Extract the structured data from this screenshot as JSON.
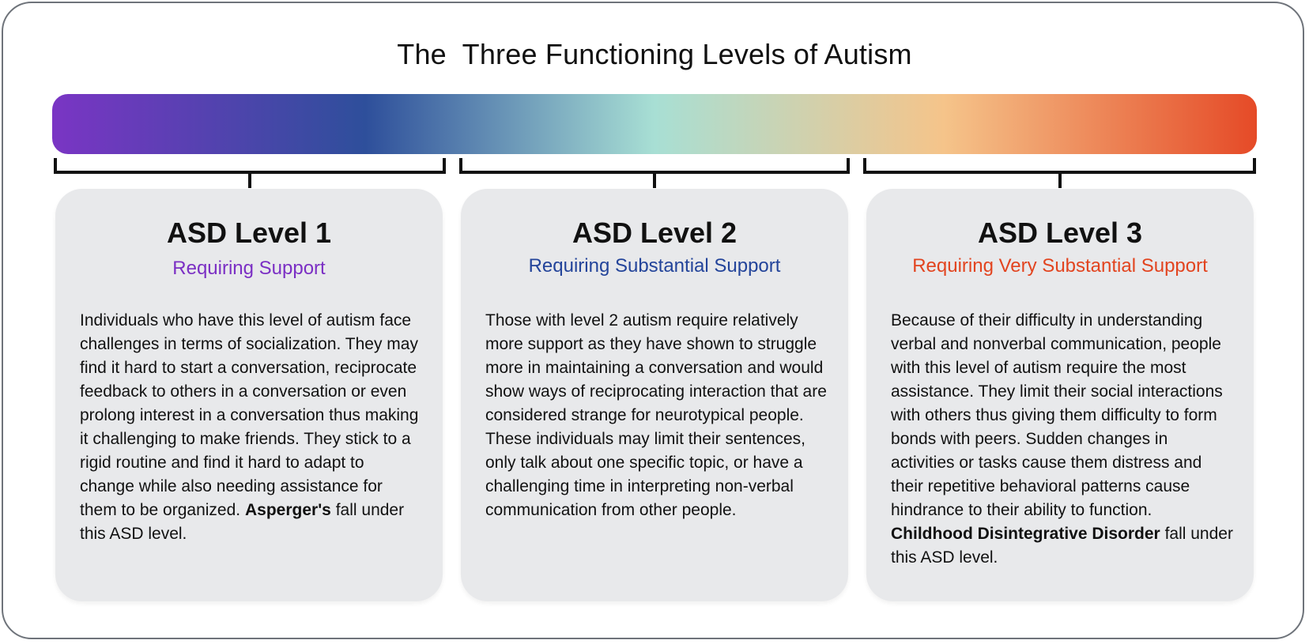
{
  "title": "The  Three Functioning Levels of Autism",
  "spectrum_colors": [
    "#7a35c4",
    "#2e4f9b",
    "#a8dfd4",
    "#f5c48a",
    "#e54a27"
  ],
  "levels": [
    {
      "heading": "ASD Level 1",
      "subtitle": "Requiring Support",
      "subtitle_color": "#7b2fc4",
      "body": "Individuals who have this level of autism face challenges in terms of socialization. They may find it hard to start a conversation, reciprocate feedback to others in a conversation or even prolong interest in a conversation thus making it challenging to make friends. They stick to a rigid routine and find it hard to adapt to change while also needing assistance for them to be organized.",
      "body_bold": "Asperger's",
      "body_end": "fall under this ASD level."
    },
    {
      "heading": "ASD Level 2",
      "subtitle": "Requiring Substantial Support",
      "subtitle_color": "#23449a",
      "body": "Those with level 2 autism require relatively more support as they have shown to struggle more in maintaining a conversation and would show ways of reciprocating interaction that are considered strange for neurotypical people. These individuals may limit their sentences, only talk about one specific topic, or have a challenging time in interpreting non-verbal communication from other people.",
      "body_bold": "",
      "body_end": ""
    },
    {
      "heading": "ASD Level 3",
      "subtitle": "Requiring Very Substantial Support",
      "subtitle_color": "#e2441f",
      "body": "Because of their difficulty in understanding verbal and nonverbal communication, people with this level of autism require the most assistance. They limit their social interactions with others thus giving them difficulty to form bonds with peers. Sudden changes in activities or tasks cause them distress and their repetitive behavioral patterns cause hindrance to their ability to function.",
      "body_bold": "Childhood Disintegrative Disorder",
      "body_end": "fall under this ASD level."
    }
  ]
}
